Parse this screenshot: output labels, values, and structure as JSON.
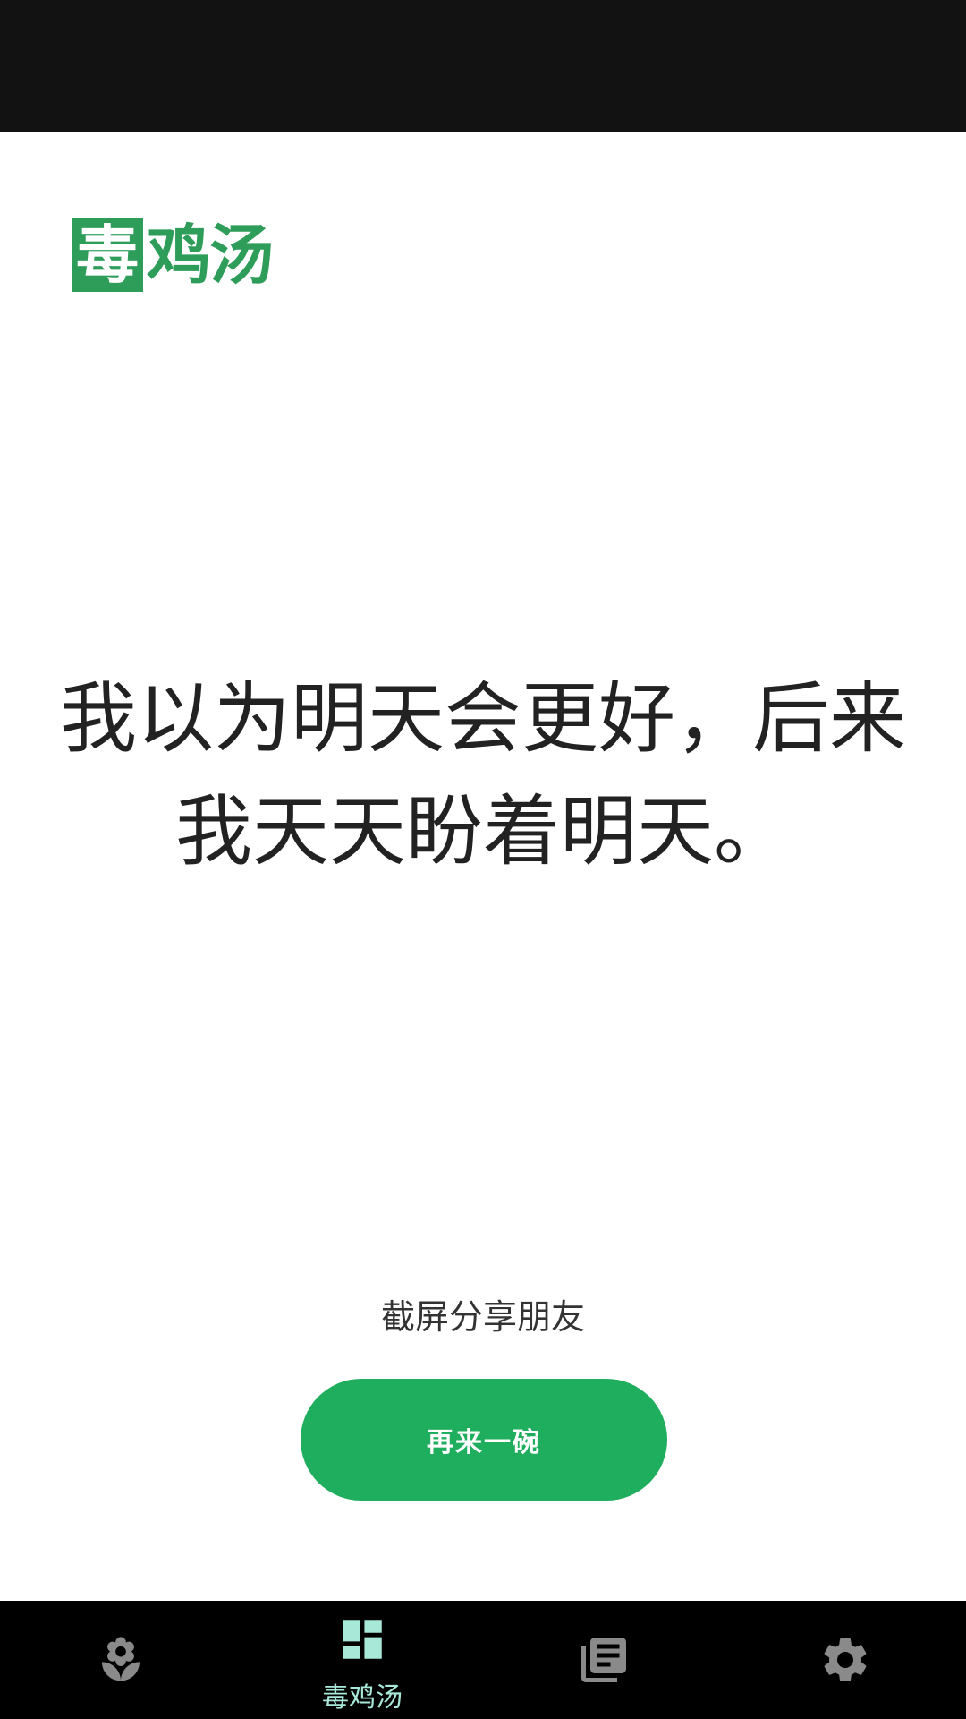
{
  "app": {
    "logo_char1": "毒",
    "logo_rest": "鸡汤"
  },
  "main": {
    "quote": "我以为明天会更好，后来我天天盼着明天。",
    "share_text": "截屏分享朋友",
    "again_button_label": "再来一碗"
  },
  "nav": {
    "items": [
      {
        "icon": "lotus-icon",
        "label": ""
      },
      {
        "icon": "dashboard-icon",
        "label": "毒鸡汤"
      },
      {
        "icon": "library-books-icon",
        "label": ""
      },
      {
        "icon": "gear-icon",
        "label": ""
      }
    ],
    "active_color": "#a7e8d8",
    "inactive_color": "#8a8a8a"
  },
  "colors": {
    "accent_green": "#1fae5d",
    "logo_green": "#2e9d5a",
    "status_bar": "#121212",
    "nav_bg": "#000000"
  }
}
